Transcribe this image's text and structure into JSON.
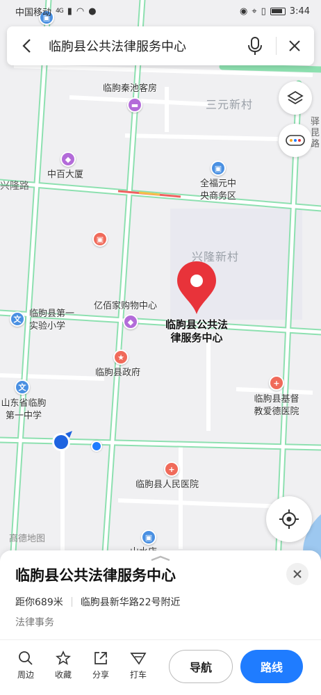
{
  "status_bar": {
    "carrier": "中国移动",
    "signal": "4G",
    "time": "3:44"
  },
  "search": {
    "query": "临朐县公共法律服务中心"
  },
  "map": {
    "areas": {
      "sanyuan": "三元新村",
      "xinglong_village": "兴隆新村"
    },
    "roads": {
      "xinglong_road": "兴隆路"
    },
    "edge_text": "驿\n昆\n路",
    "pois": {
      "qinchi_hotel": "临朐秦池客房",
      "zhongbai": "中百大厦",
      "quanfuyuan_1": "全福元中",
      "quanfuyuan_2": "央商务区",
      "yibaijia": "亿佰家购物中心",
      "school_1": "临朐县第一",
      "school_2": "实验小学",
      "government": "临朐县政府",
      "middle_school_1": "山东省临朐",
      "middle_school_2": "第一中学",
      "church_hospital_1": "临朐县基督",
      "church_hospital_2": "教爱德医院",
      "people_hospital": "临朐县人民医院",
      "bottom_partial": "山水店"
    },
    "target_label_1": "临朐县公共法",
    "target_label_2": "律服务中心",
    "watermark": "高德地图"
  },
  "sheet": {
    "title": "临朐县公共法律服务中心",
    "distance": "距你689米",
    "address": "临朐县新华路22号附近",
    "category": "法律事务"
  },
  "actions": {
    "nearby": "周边",
    "favorite": "收藏",
    "share": "分享",
    "taxi": "打车",
    "navigate": "导航",
    "route": "路线"
  },
  "colors": {
    "accent": "#1f7cff",
    "pin": "#e8333a",
    "road": "#8de0b0"
  }
}
